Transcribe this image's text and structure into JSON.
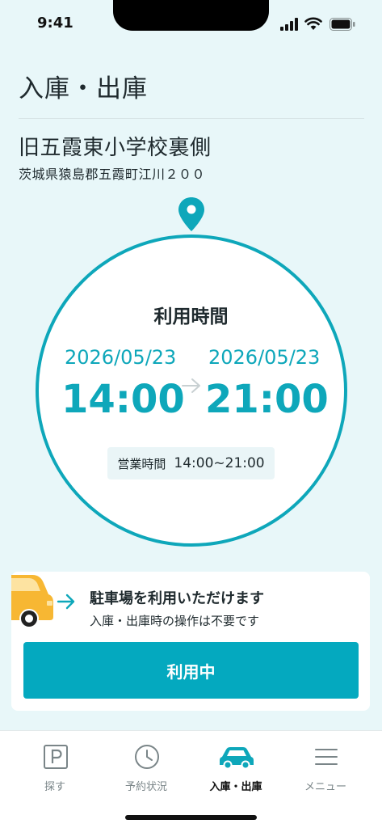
{
  "status_bar": {
    "time": "9:41"
  },
  "page": {
    "title": "入庫・出庫"
  },
  "location": {
    "name": "旧五霞東小学校裏側",
    "address": "茨城県猿島郡五霞町江川２００"
  },
  "usage": {
    "heading": "利用時間",
    "start_date": "2026/05/23",
    "start_time": "14:00",
    "end_date": "2026/05/23",
    "end_time": "21:00",
    "business_hours_label": "営業時間",
    "business_hours_value": "14:00~21:00"
  },
  "notice": {
    "title": "駐車場を利用いただけます",
    "subtitle": "入庫・出庫時の操作は不要です",
    "button_label": "利用中"
  },
  "tabs": [
    {
      "label": "探す",
      "icon": "parking-icon"
    },
    {
      "label": "予約状況",
      "icon": "clock-icon"
    },
    {
      "label": "入庫・出庫",
      "icon": "car-icon"
    },
    {
      "label": "メニュー",
      "icon": "menu-icon"
    }
  ],
  "colors": {
    "accent": "#0ea7ba",
    "button": "#04a9bf",
    "background": "#e8f7f9",
    "car": "#f7b733"
  }
}
